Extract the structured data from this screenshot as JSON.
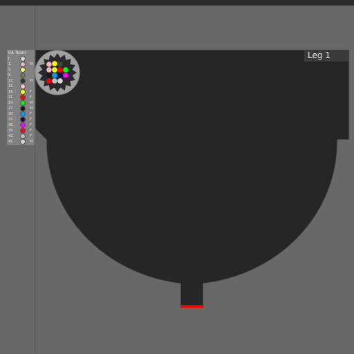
{
  "leg_label": "Leg 1",
  "team_panel": {
    "title": "0A Team",
    "rows": [
      {
        "num": "C.",
        "color": "#d8d8d8",
        "tag": ""
      },
      {
        "num": "1.",
        "color": "#f4b6c2",
        "tag": "M"
      },
      {
        "num": "5.",
        "color": "#f4f46a",
        "tag": ""
      },
      {
        "num": "9.",
        "color": "#6a7a6a",
        "tag": ""
      },
      {
        "num": "12.",
        "color": "#2e3a2e",
        "tag": "M"
      },
      {
        "num": "15.",
        "color": "#f4c6d0",
        "tag": ""
      },
      {
        "num": "18.",
        "color": "#ffff00",
        "tag": "F"
      },
      {
        "num": "21.",
        "color": "#ff0000",
        "tag": "F"
      },
      {
        "num": "24.",
        "color": "#00ff00",
        "tag": "M"
      },
      {
        "num": "27.",
        "color": "#1a1a1a",
        "tag": "M"
      },
      {
        "num": "30.",
        "color": "#00a0ff",
        "tag": "F"
      },
      {
        "num": "33.",
        "color": "#1a0a4a",
        "tag": "F"
      },
      {
        "num": "36.",
        "color": "#ff00ff",
        "tag": "F"
      },
      {
        "num": "39.",
        "color": "#ff0030",
        "tag": "F"
      },
      {
        "num": "42.",
        "color": "#c0c0c0",
        "tag": "F"
      },
      {
        "num": "45.",
        "color": "#d8d8d8",
        "tag": "M"
      }
    ]
  },
  "wheel_marbles": [
    "#f4b6c2",
    "#ffff00",
    "#3a4a3a",
    "#f4b6c2",
    "#ffff00",
    "#ff0000",
    "#00ff00",
    "#1a1a1a",
    "#00a0ff",
    "#1a0a4a",
    "#ff00ff",
    "#ff0000",
    "#c0c0c0",
    "#d8d8d8"
  ],
  "colors": {
    "track": "#262626",
    "finish_line": "#ff0000",
    "panel": "#828282",
    "background": "#686868"
  }
}
